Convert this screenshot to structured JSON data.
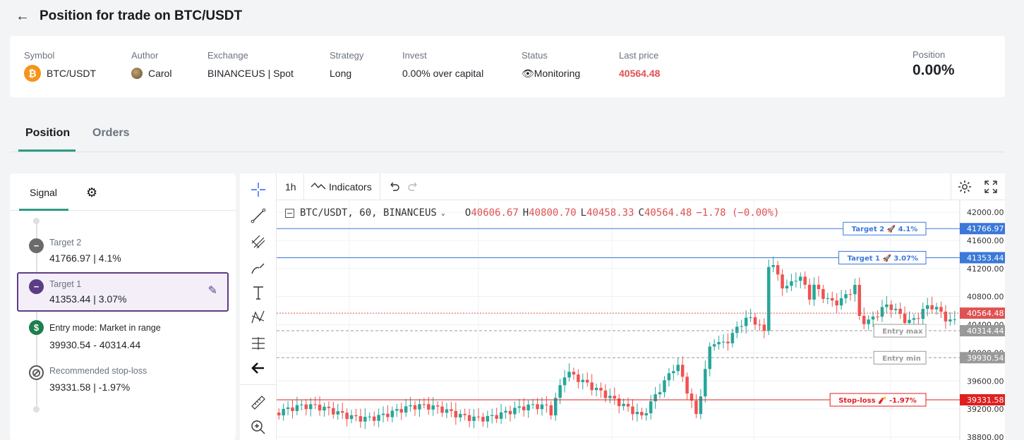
{
  "header": {
    "title": "Position for trade on BTC/USDT"
  },
  "info": {
    "symbol_label": "Symbol",
    "symbol_value": "BTC/USDT",
    "author_label": "Author",
    "author_value": "Carol",
    "exchange_label": "Exchange",
    "exchange_value": "BINANCEUS | Spot",
    "strategy_label": "Strategy",
    "strategy_value": "Long",
    "invest_label": "Invest",
    "invest_value": "0.00% over capital",
    "status_label": "Status",
    "status_value": "Monitoring",
    "lastprice_label": "Last price",
    "lastprice_value": "40564.48",
    "position_label": "Position",
    "position_value": "0.00%"
  },
  "tabs": {
    "active": "Position",
    "inactive": "Orders"
  },
  "signal": {
    "tab_label": "Signal",
    "steps": [
      {
        "title": "Target 2",
        "value": "41766.97 | 4.1%"
      },
      {
        "title": "Target 1",
        "value": "41353.44 | 3.07%"
      },
      {
        "title": "Entry mode: Market in range",
        "value": "39930.54 - 40314.44"
      },
      {
        "title": "Recommended stop-loss",
        "value": "39331.58 | -1.97%"
      }
    ]
  },
  "chart_toolbar": {
    "interval": "1h",
    "indicators": "Indicators"
  },
  "chart_legend": {
    "title": "BTC/USDT, 60, BINANCEUS",
    "o_label": "O",
    "o": "40606.67",
    "h_label": "H",
    "h": "40800.70",
    "l_label": "L",
    "l": "40458.33",
    "c_label": "C",
    "c": "40564.48",
    "change": "−1.78 (−0.00%)"
  },
  "chart_data": {
    "type": "candlestick",
    "y_ticks": [
      "42000.00",
      "41600.00",
      "41200.00",
      "40800.00",
      "40400.00",
      "40000.00",
      "39600.00",
      "39200.00",
      "38800.00"
    ],
    "price_lines": [
      {
        "label": "Target 2 🚀 4.1%",
        "value": 41766.97,
        "tag": "41766.97",
        "color": "#3b78d8"
      },
      {
        "label": "Target 1 🚀 3.07%",
        "value": 41353.44,
        "tag": "41353.44",
        "color": "#3b78d8"
      },
      {
        "label": "",
        "value": 40564.48,
        "tag": "40564.48",
        "color": "#e05252"
      },
      {
        "label": "Entry max",
        "value": 40314.44,
        "tag": "40314.44",
        "color": "#999999"
      },
      {
        "label": "Entry min",
        "value": 39930.54,
        "tag": "39930.54",
        "color": "#999999"
      },
      {
        "label": "Stop-loss 🧨 -1.97%",
        "value": 39331.58,
        "tag": "39331.58",
        "color": "#e02020"
      }
    ],
    "colors": {
      "up": "#26a69a",
      "down": "#ef5350"
    }
  }
}
